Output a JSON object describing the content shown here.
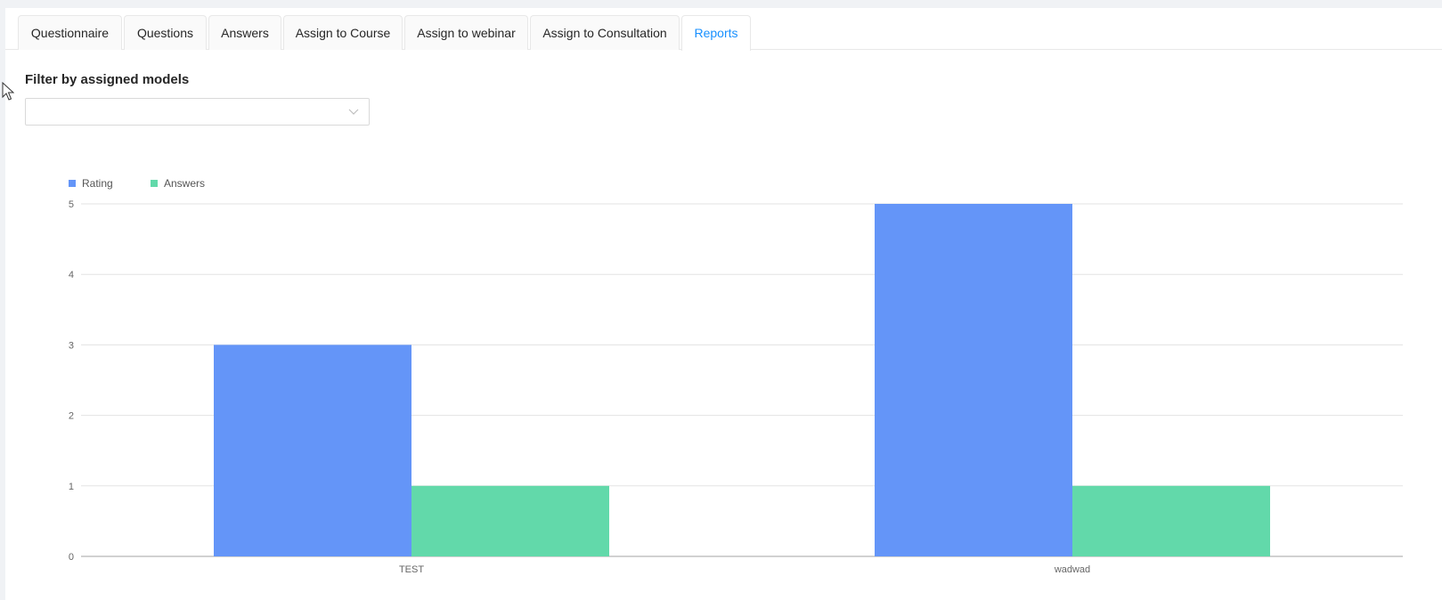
{
  "tabs": [
    {
      "label": "Questionnaire",
      "active": false
    },
    {
      "label": "Questions",
      "active": false
    },
    {
      "label": "Answers",
      "active": false
    },
    {
      "label": "Assign to Course",
      "active": false
    },
    {
      "label": "Assign to webinar",
      "active": false
    },
    {
      "label": "Assign to Consultation",
      "active": false
    },
    {
      "label": "Reports",
      "active": true
    }
  ],
  "filter": {
    "title": "Filter by assigned models",
    "value": "",
    "icon": "chevron-down-icon"
  },
  "colors": {
    "active_tab": "#1890ff",
    "rating": "#6495f8",
    "answers": "#62d9aa"
  },
  "chart_data": {
    "type": "bar",
    "categories": [
      "TEST",
      "wadwad"
    ],
    "series": [
      {
        "name": "Rating",
        "values": [
          3,
          5
        ],
        "color": "#6495f8"
      },
      {
        "name": "Answers",
        "values": [
          1,
          1
        ],
        "color": "#62d9aa"
      }
    ],
    "ylim": [
      0,
      5
    ],
    "yticks": [
      0,
      1,
      2,
      3,
      4,
      5
    ],
    "grid": true,
    "legend_position": "top-left"
  }
}
